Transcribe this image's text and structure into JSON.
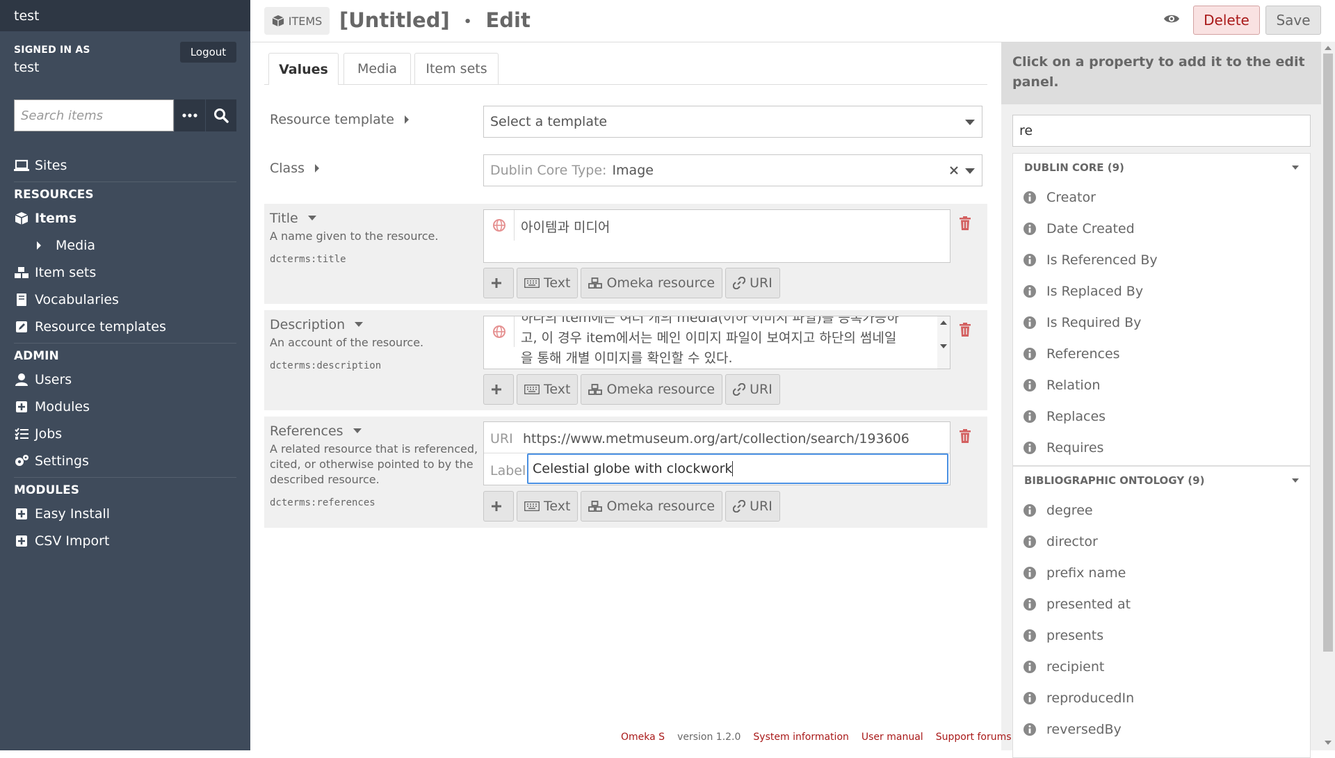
{
  "sidebar": {
    "site_title": "test",
    "signed_in_label": "SIGNED IN AS",
    "username": "test",
    "logout": "Logout",
    "search_placeholder": "Search items",
    "nav": {
      "sites": "Sites",
      "resources_header": "RESOURCES",
      "items": "Items",
      "media": "Media",
      "item_sets": "Item sets",
      "vocabularies": "Vocabularies",
      "resource_templates": "Resource templates",
      "admin_header": "ADMIN",
      "users": "Users",
      "modules": "Modules",
      "jobs": "Jobs",
      "settings": "Settings",
      "modules_header": "MODULES",
      "easy_install": "Easy Install",
      "csv_import": "CSV Import"
    }
  },
  "header": {
    "badge": "ITEMS",
    "title": "[Untitled]",
    "separator": "•",
    "action": "Edit",
    "delete": "Delete",
    "save": "Save"
  },
  "tabs": [
    "Values",
    "Media",
    "Item sets"
  ],
  "form": {
    "resource_template": {
      "label": "Resource template",
      "value": "Select a template"
    },
    "class": {
      "label": "Class",
      "prefix": "Dublin Core Type:",
      "value": "Image"
    },
    "title_field": {
      "label": "Title",
      "description": "A name given to the resource.",
      "term": "dcterms:title",
      "value": "아이템과 미디어"
    },
    "description_field": {
      "label": "Description",
      "description": "An account of the resource.",
      "term": "dcterms:description",
      "line1": "하나의 item에는 여러 개의 media(이하 이미지 파일)를 등록가능하",
      "line2": "고, 이 경우 item에서는 메인 이미지 파일이 보여지고 하단의 썸네일",
      "line3": "을 통해 개별 이미지를 확인할 수 있다."
    },
    "references_field": {
      "label": "References",
      "description": "A related resource that is referenced, cited, or otherwise pointed to by the described resource.",
      "term": "dcterms:references",
      "uri_label": "URI",
      "uri_value": "https://www.metmuseum.org/art/collection/search/193606",
      "label_label": "Label",
      "label_value": "Celestial globe with clockwork"
    },
    "buttons": {
      "text": "Text",
      "omeka": "Omeka resource",
      "uri": "URI"
    }
  },
  "panel": {
    "instructions": "Click on a property to add it to the edit panel.",
    "filter_value": "re",
    "dublin_core": {
      "heading": "DUBLIN CORE (9)",
      "items": [
        "Creator",
        "Date Created",
        "Is Referenced By",
        "Is Replaced By",
        "Is Required By",
        "References",
        "Relation",
        "Replaces",
        "Requires"
      ]
    },
    "bibo": {
      "heading": "BIBLIOGRAPHIC ONTOLOGY (9)",
      "items": [
        "degree",
        "director",
        "prefix name",
        "presented at",
        "presents",
        "recipient",
        "reproducedIn",
        "reversedBy"
      ]
    }
  },
  "footer": {
    "omeka": "Omeka S",
    "version": "version 1.2.0",
    "system_info": "System information",
    "user_manual": "User manual",
    "support": "Support forums"
  },
  "colors": {
    "sidebar": "#3f4b5b",
    "accent_red": "#a91919",
    "panel_bg": "#f0f0f0"
  }
}
